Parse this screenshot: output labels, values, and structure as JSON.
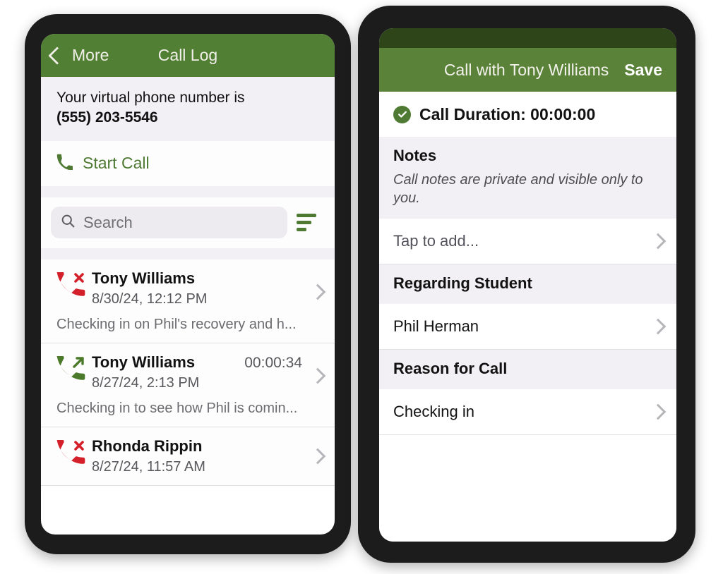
{
  "colors": {
    "header_green_left": "#517f33",
    "header_green_right": "#5a8238",
    "strip_dark_green": "#2e4519",
    "accent_green": "#4f7a33",
    "missed_red": "#d3202a",
    "panel_gray": "#f2f0f5",
    "bezel": "#1d1c1c"
  },
  "call_log": {
    "nav": {
      "back_icon": "chevron-left-icon",
      "back_label": "More",
      "title": "Call Log"
    },
    "virtual_number": {
      "label": "Your virtual phone number is",
      "number": "(555) 203-5546"
    },
    "start_call": {
      "icon": "phone-icon",
      "label": "Start Call"
    },
    "search": {
      "icon": "search-icon",
      "placeholder": "Search",
      "value": "",
      "filter_icon": "filter-sort-icon"
    },
    "entries": [
      {
        "icon": "missed-call-icon",
        "direction": "missed",
        "name": "Tony Williams",
        "duration": "",
        "timestamp": "8/30/24, 12:12 PM",
        "note": "Checking in on Phil's recovery and h...",
        "chevron": "chevron-right-icon"
      },
      {
        "icon": "outgoing-call-icon",
        "direction": "outgoing",
        "name": "Tony Williams",
        "duration": "00:00:34",
        "timestamp": "8/27/24, 2:13 PM",
        "note": "Checking in to see how Phil is comin...",
        "chevron": "chevron-right-icon"
      },
      {
        "icon": "missed-call-icon",
        "direction": "missed",
        "name": "Rhonda Rippin",
        "duration": "",
        "timestamp": "8/27/24, 11:57 AM",
        "note": "",
        "chevron": "chevron-right-icon"
      }
    ]
  },
  "call_detail": {
    "nav": {
      "title": "Call with Tony Williams",
      "save_label": "Save"
    },
    "duration": {
      "icon": "check-circle-icon",
      "label": "Call Duration: 00:00:00"
    },
    "notes": {
      "title": "Notes",
      "subtitle": "Call notes are private and visible only to you.",
      "placeholder": "Tap to add...",
      "chevron": "chevron-right-icon"
    },
    "regarding_student": {
      "title": "Regarding Student",
      "value": "Phil Herman",
      "chevron": "chevron-right-icon"
    },
    "reason_for_call": {
      "title": "Reason for Call",
      "value": "Checking in",
      "chevron": "chevron-right-icon"
    }
  }
}
